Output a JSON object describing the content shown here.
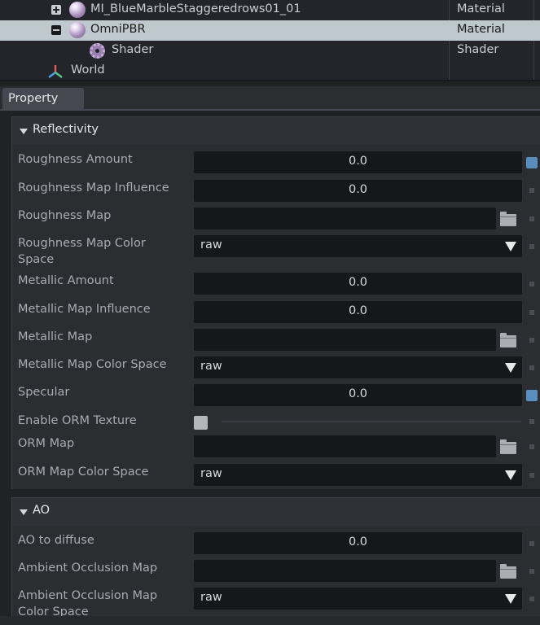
{
  "tree": {
    "rows": [
      {
        "name": "MI_BlueMarbleStaggeredrows01_01",
        "type": "Material",
        "expander": "plus-icon",
        "icon": "material-sphere-icon"
      },
      {
        "name": "OmniPBR",
        "type": "Material",
        "expander": "minus-icon",
        "icon": "material-sphere-icon",
        "selected": true
      },
      {
        "name": "Shader",
        "type": "Shader",
        "icon": "shader-gear-icon"
      },
      {
        "name": "World",
        "type": "",
        "icon": "world-axes-icon"
      }
    ]
  },
  "tabs": {
    "property": "Property"
  },
  "reflectivity": {
    "title": "Reflectivity",
    "roughness_amount": {
      "label": "Roughness Amount",
      "value": "0.0"
    },
    "roughness_map_influence": {
      "label": "Roughness Map Influence",
      "value": "0.0"
    },
    "roughness_map": {
      "label": "Roughness Map",
      "value": ""
    },
    "roughness_map_color_space": {
      "label": "Roughness Map Color Space",
      "value": "raw"
    },
    "metallic_amount": {
      "label": "Metallic Amount",
      "value": "0.0"
    },
    "metallic_map_influence": {
      "label": "Metallic Map Influence",
      "value": "0.0"
    },
    "metallic_map": {
      "label": "Metallic Map",
      "value": ""
    },
    "metallic_map_color_space": {
      "label": "Metallic Map Color Space",
      "value": "raw"
    },
    "specular": {
      "label": "Specular",
      "value": "0.0"
    },
    "enable_orm_texture": {
      "label": "Enable ORM Texture",
      "checked": false
    },
    "orm_map": {
      "label": "ORM Map",
      "value": ""
    },
    "orm_map_color_space": {
      "label": "ORM Map Color Space",
      "value": "raw"
    }
  },
  "ao": {
    "title": "AO",
    "ao_to_diffuse": {
      "label": "AO to diffuse",
      "value": "0.0"
    },
    "ambient_occlusion_map": {
      "label": "Ambient Occlusion Map",
      "value": ""
    },
    "ambient_occlusion_map_color_space": {
      "label": "Ambient Occlusion Map Color Space",
      "value": "raw"
    }
  },
  "colors": {
    "selection": "#bfc8cf",
    "override_marker": "#5a8ebf",
    "field_bg": "#16171a",
    "panel_bg": "#2b2d31"
  }
}
